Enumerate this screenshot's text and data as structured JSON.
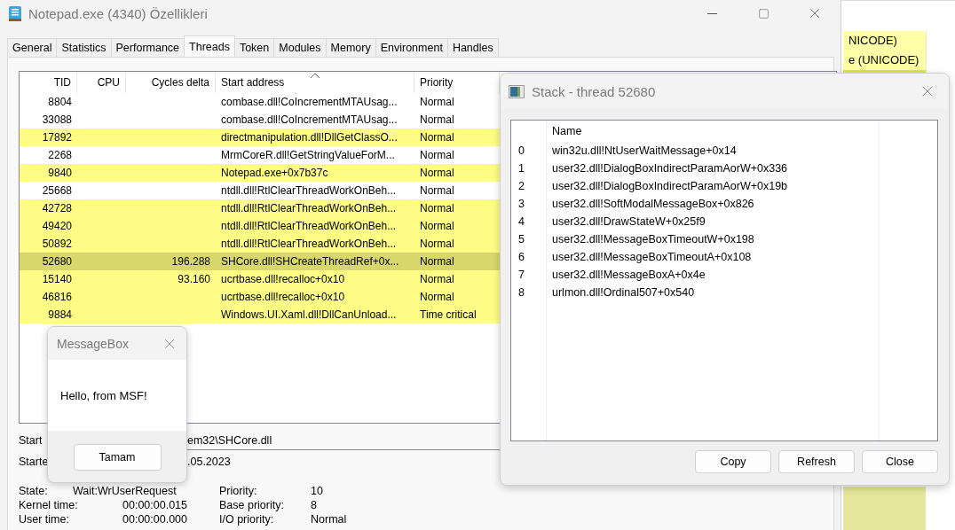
{
  "background_window": {
    "rows": [
      {
        "text": "NICODE)"
      },
      {
        "text": "e (UNICODE)"
      }
    ]
  },
  "window": {
    "title": "Notepad.exe (4340) Özellikleri"
  },
  "tabs": [
    {
      "label": "General",
      "selected": false
    },
    {
      "label": "Statistics",
      "selected": false
    },
    {
      "label": "Performance",
      "selected": false
    },
    {
      "label": "Threads",
      "selected": true
    },
    {
      "label": "Token",
      "selected": false
    },
    {
      "label": "Modules",
      "selected": false
    },
    {
      "label": "Memory",
      "selected": false
    },
    {
      "label": "Environment",
      "selected": false
    },
    {
      "label": "Handles",
      "selected": false
    }
  ],
  "threads_table": {
    "columns": [
      {
        "label": "TID",
        "sorted": false
      },
      {
        "label": "CPU",
        "sorted": false
      },
      {
        "label": "Cycles delta",
        "sorted": false
      },
      {
        "label": "Start address",
        "sorted": true
      },
      {
        "label": "Priority",
        "sorted": false
      }
    ],
    "rows": [
      {
        "tid": "8804",
        "start_address": "combase.dll!CoIncrementMTAUsag...",
        "priority": "Normal",
        "highlighted": false,
        "selected": false
      },
      {
        "tid": "33088",
        "start_address": "combase.dll!CoIncrementMTAUsag...",
        "priority": "Normal",
        "highlighted": false,
        "selected": false
      },
      {
        "tid": "17892",
        "start_address": "directmanipulation.dll!DllGetClassO...",
        "priority": "Normal",
        "highlighted": true,
        "selected": false
      },
      {
        "tid": "2268",
        "start_address": "MrmCoreR.dll!GetStringValueForM...",
        "priority": "Normal",
        "highlighted": false,
        "selected": false
      },
      {
        "tid": "9840",
        "start_address": "Notepad.exe+0x7b37c",
        "priority": "Normal",
        "highlighted": true,
        "selected": false
      },
      {
        "tid": "25668",
        "start_address": "ntdll.dll!RtlClearThreadWorkOnBeh...",
        "priority": "Normal",
        "highlighted": false,
        "selected": false
      },
      {
        "tid": "42728",
        "start_address": "ntdll.dll!RtlClearThreadWorkOnBeh...",
        "priority": "Normal",
        "highlighted": true,
        "selected": false
      },
      {
        "tid": "49420",
        "start_address": "ntdll.dll!RtlClearThreadWorkOnBeh...",
        "priority": "Normal",
        "highlighted": true,
        "selected": false
      },
      {
        "tid": "50892",
        "start_address": "ntdll.dll!RtlClearThreadWorkOnBeh...",
        "priority": "Normal",
        "highlighted": true,
        "selected": false
      },
      {
        "tid": "52680",
        "cycles_delta": "196.288",
        "start_address": "SHCore.dll!SHCreateThreadRef+0x...",
        "priority": "Normal",
        "highlighted": true,
        "selected": true
      },
      {
        "tid": "15140",
        "cycles_delta": "93.160",
        "start_address": "ucrtbase.dll!recalloc+0x10",
        "priority": "Normal",
        "highlighted": true,
        "selected": false
      },
      {
        "tid": "46816",
        "start_address": "ucrtbase.dll!recalloc+0x10",
        "priority": "Normal",
        "highlighted": true,
        "selected": false
      },
      {
        "tid": "9884",
        "start_address": "Windows.UI.Xaml.dll!DllCanUnload...",
        "priority": "Time critical",
        "highlighted": true,
        "selected": false
      }
    ]
  },
  "details": {
    "start_label": "Start",
    "start_value": "em32\\SHCore.dll",
    "started_label": "Starte",
    "started_value": ".05.2023",
    "state_label": "State:",
    "state_value": "Wait:WrUserRequest",
    "priority_label": "Priority:",
    "priority_value": "10",
    "kernel_time_label": "Kernel time:",
    "kernel_time_value": "00:00:00.015",
    "base_priority_label": "Base priority:",
    "base_priority_value": "8",
    "user_time_label": "User time:",
    "user_time_value": "00:00:00.000",
    "io_priority_label": "I/O priority:",
    "io_priority_value": "Normal"
  },
  "message_box": {
    "title": "MessageBox",
    "text": "Hello, from MSF!",
    "button": "Tamam"
  },
  "stack_window": {
    "title": "Stack - thread 52680",
    "column": "Name",
    "frames": [
      {
        "index": "0",
        "name": "win32u.dll!NtUserWaitMessage+0x14"
      },
      {
        "index": "1",
        "name": "user32.dll!DialogBoxIndirectParamAorW+0x336"
      },
      {
        "index": "2",
        "name": "user32.dll!DialogBoxIndirectParamAorW+0x19b"
      },
      {
        "index": "3",
        "name": "user32.dll!SoftModalMessageBox+0x826"
      },
      {
        "index": "4",
        "name": "user32.dll!DrawStateW+0x25f9"
      },
      {
        "index": "5",
        "name": "user32.dll!MessageBoxTimeoutW+0x198"
      },
      {
        "index": "6",
        "name": "user32.dll!MessageBoxTimeoutA+0x108"
      },
      {
        "index": "7",
        "name": "user32.dll!MessageBoxA+0x4e"
      },
      {
        "index": "8",
        "name": "urlmon.dll!Ordinal507+0x540"
      }
    ],
    "buttons": [
      "Copy",
      "Refresh",
      "Close"
    ]
  }
}
